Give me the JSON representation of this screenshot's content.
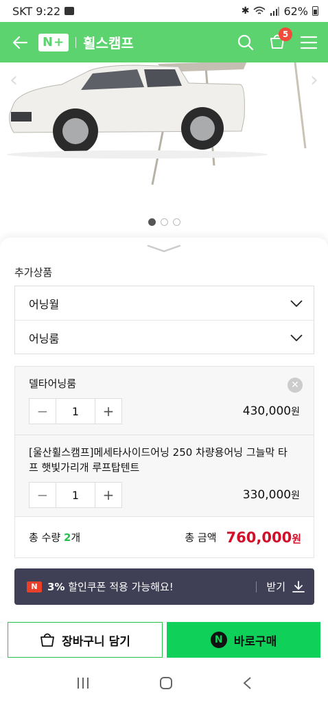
{
  "status_bar": {
    "carrier_time": "SKT 9:22",
    "battery": "62%"
  },
  "header": {
    "logo_text": "N+",
    "store_name": "휠스캠프",
    "cart_count": "5"
  },
  "carousel": {
    "dots": 3,
    "active_index": 0
  },
  "sheet": {
    "section_label": "추가상품",
    "options": [
      {
        "label": "어닝월"
      },
      {
        "label": "어닝룸"
      }
    ],
    "selected_items": [
      {
        "name": "델타어닝룸",
        "qty": "1",
        "price": "430,000",
        "unit": "원"
      },
      {
        "name": "[울산휠스캠프]메세타사이드어닝 250 차량용어닝 그늘막 타프 햇빛가리개 루프탑텐트",
        "qty": "1",
        "price": "330,000",
        "unit": "원"
      }
    ],
    "total": {
      "qty_prefix": "총 수량 ",
      "qty_value": "2",
      "qty_suffix": "개",
      "amount_label": "총 금액",
      "amount_value": "760,000",
      "amount_unit": "원"
    },
    "coupon": {
      "badge": "N",
      "highlight": "3%",
      "text": " 할인쿠폰 적용 가능해요!",
      "action": "받기"
    }
  },
  "actions": {
    "cart_label": "장바구니 담기",
    "buy_label": "바로구매",
    "buy_badge": "N"
  },
  "colors": {
    "brand_green": "#5dd36f",
    "buy_green": "#0fd15a",
    "price_red": "#d0102a",
    "coupon_bg": "#3f3f55"
  }
}
